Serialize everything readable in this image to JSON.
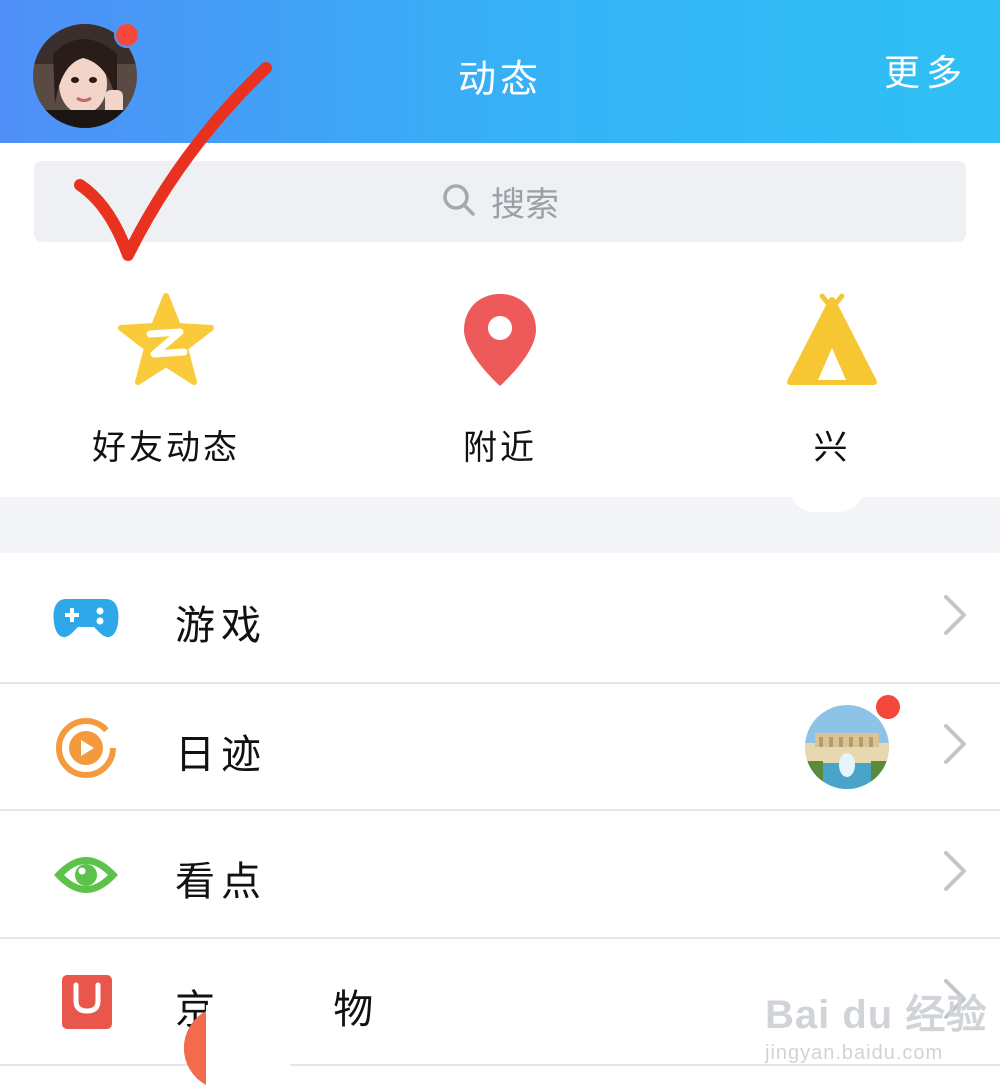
{
  "header": {
    "title": "动态",
    "more_label": "更多"
  },
  "search": {
    "placeholder": "搜索"
  },
  "quick_entries": [
    {
      "label": "好友动态",
      "icon": "qzone-star-icon"
    },
    {
      "label": "附近",
      "icon": "location-pin-icon"
    },
    {
      "label": "兴",
      "icon": "tent-icon"
    }
  ],
  "list": [
    {
      "label": "游戏",
      "icon": "gamepad-icon"
    },
    {
      "label": "日迹",
      "icon": "play-ring-icon"
    },
    {
      "label": "看点",
      "icon": "eye-icon"
    },
    {
      "label": "京      物",
      "icon": "jd-bag-icon"
    }
  ],
  "watermark": {
    "main": "Bai du 经验",
    "sub": "jingyan.baidu.com"
  },
  "colors": {
    "header_start": "#4f8ff7",
    "header_end": "#2fc0f5",
    "badge_red": "#f5483c",
    "star_yellow": "#f9cb3a",
    "pin_red": "#ee5a5a",
    "tent_yellow": "#f7c733",
    "game_blue": "#2fa8ea",
    "rijì_orange": "#f39a3d",
    "eye_green": "#5cc24a",
    "jd_red": "#e9564b"
  }
}
